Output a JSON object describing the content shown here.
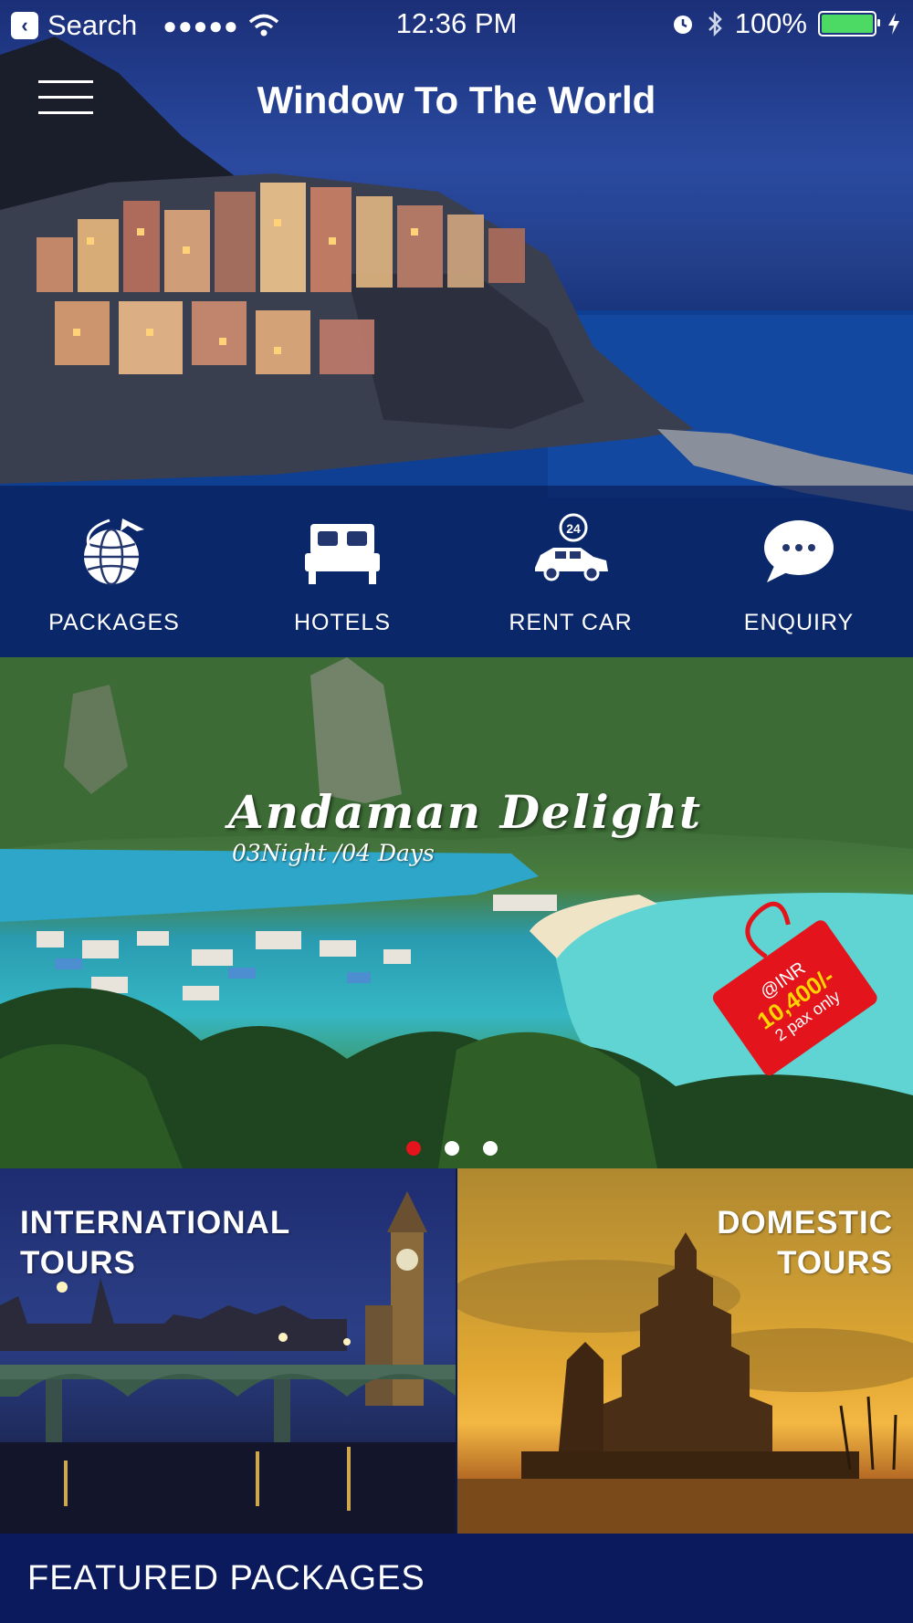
{
  "status_bar": {
    "back_label": "Search",
    "signal": "●●●●●",
    "time": "12:36 PM",
    "battery_text": "100%",
    "battery_level": 1.0
  },
  "header": {
    "title": "Window To The World"
  },
  "quick_nav": [
    {
      "label": "PACKAGES",
      "icon": "globe-plane-icon"
    },
    {
      "label": "HOTELS",
      "icon": "bed-icon"
    },
    {
      "label": "RENT CAR",
      "icon": "car-24-icon"
    },
    {
      "label": "ENQUIRY",
      "icon": "chat-bubble-icon"
    }
  ],
  "promo": {
    "title": "Andaman Delight",
    "subtitle": "03Night /04 Days",
    "price_tag": {
      "line1": "@INR",
      "line2": "10,400/-",
      "line3": "2 pax only"
    },
    "slides_total": 3,
    "active_slide": 1
  },
  "tiles": {
    "international": {
      "line1": "INTERNATIONAL",
      "line2": "TOURS"
    },
    "domestic": {
      "line1": "DOMESTIC",
      "line2": "TOURS"
    }
  },
  "featured": {
    "title": "FEATURED PACKAGES"
  },
  "colors": {
    "nav_background": "#0a1a55",
    "accent_red": "#e3141b",
    "tag_yellow": "#ffd400",
    "battery_green": "#4cd964"
  }
}
